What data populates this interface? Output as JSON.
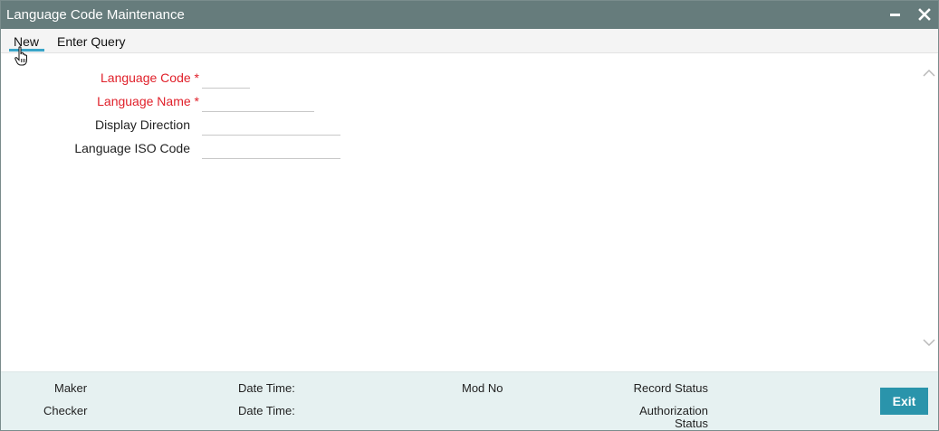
{
  "window": {
    "title": "Language Code Maintenance",
    "minimize_icon": "minimize-icon",
    "close_icon": "close-icon"
  },
  "toolbar": {
    "new_label": "New",
    "enter_query_label": "Enter Query"
  },
  "form": {
    "language_code": {
      "label": "Language Code",
      "required": "*",
      "value": ""
    },
    "language_name": {
      "label": "Language Name",
      "required": "*",
      "value": ""
    },
    "display_direction": {
      "label": "Display Direction",
      "value": ""
    },
    "language_iso_code": {
      "label": "Language ISO Code",
      "value": ""
    }
  },
  "footer": {
    "maker": "Maker",
    "checker": "Checker",
    "date_time_1": "Date Time:",
    "date_time_2": "Date Time:",
    "mod_no": "Mod No",
    "record_status": "Record Status",
    "authorization_line1": "Authorization",
    "authorization_line2": "Status",
    "exit_label": "Exit"
  },
  "colors": {
    "titlebar": "#667c7c",
    "required_label": "#e0202a",
    "active_tab_underline": "#3aa5c8",
    "footer_bg": "#e6f1f1",
    "exit_button": "#2a94ab"
  }
}
